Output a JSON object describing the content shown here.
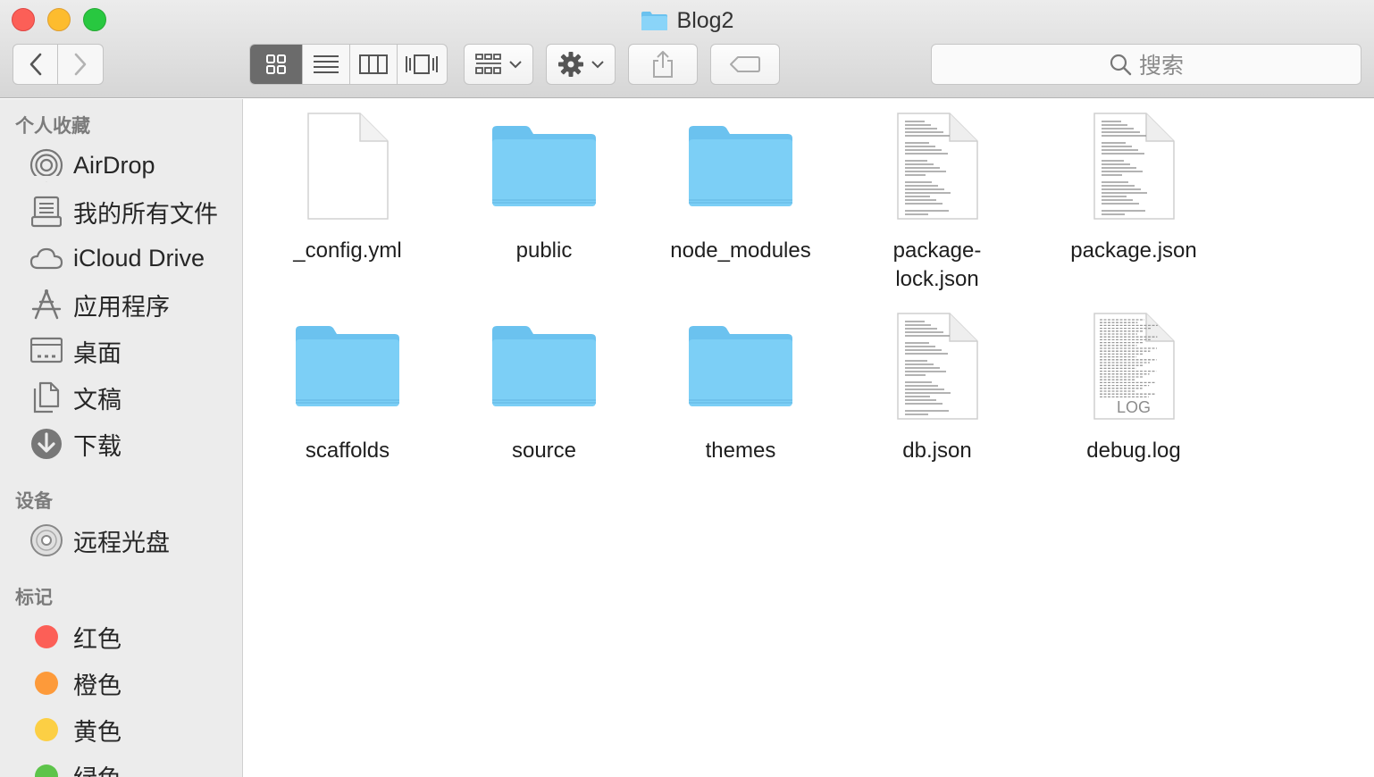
{
  "window": {
    "title": "Blog2"
  },
  "toolbar": {
    "back_icon": "chevron-left-icon",
    "forward_icon": "chevron-right-icon",
    "view_modes": [
      "icon-view",
      "list-view",
      "column-view",
      "cover-flow-view"
    ],
    "active_view": "icon-view",
    "arrange_icon": "arrange-grid-icon",
    "action_icon": "gear-icon",
    "share_icon": "share-icon",
    "tag_icon": "tag-icon",
    "search_placeholder": "搜索"
  },
  "sidebar": {
    "favorites_header": "个人收藏",
    "favorites": [
      {
        "label": "AirDrop",
        "icon": "airdrop-icon"
      },
      {
        "label": "我的所有文件",
        "icon": "all-files-icon"
      },
      {
        "label": "iCloud Drive",
        "icon": "cloud-icon"
      },
      {
        "label": "应用程序",
        "icon": "applications-icon"
      },
      {
        "label": "桌面",
        "icon": "desktop-icon"
      },
      {
        "label": "文稿",
        "icon": "documents-icon"
      },
      {
        "label": "下载",
        "icon": "download-icon"
      }
    ],
    "devices_header": "设备",
    "devices": [
      {
        "label": "远程光盘",
        "icon": "disc-icon"
      }
    ],
    "tags_header": "标记",
    "tags": [
      {
        "label": "红色",
        "color": "#fc5f57"
      },
      {
        "label": "橙色",
        "color": "#fd9a3a"
      },
      {
        "label": "黄色",
        "color": "#fccf44"
      },
      {
        "label": "绿色",
        "color": "#5dc44a"
      }
    ]
  },
  "files": [
    {
      "name": "_config.yml",
      "kind": "blank-document"
    },
    {
      "name": "public",
      "kind": "folder"
    },
    {
      "name": "node_modules",
      "kind": "folder"
    },
    {
      "name": "package-\nlock.json",
      "kind": "text-document"
    },
    {
      "name": "package.json",
      "kind": "text-document"
    },
    {
      "name": "scaffolds",
      "kind": "folder"
    },
    {
      "name": "source",
      "kind": "folder"
    },
    {
      "name": "themes",
      "kind": "folder"
    },
    {
      "name": "db.json",
      "kind": "text-document"
    },
    {
      "name": "debug.log",
      "kind": "log-document",
      "badge": "LOG"
    }
  ],
  "colors": {
    "folder_body": "#7ccff6",
    "folder_tab": "#6bc2ef",
    "active_view_bg": "#6b6b6b"
  }
}
